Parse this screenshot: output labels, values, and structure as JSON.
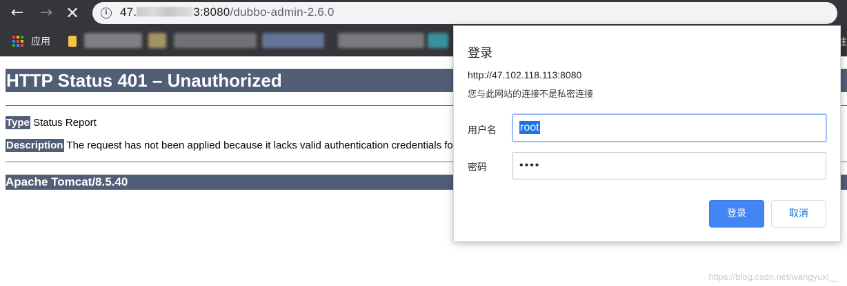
{
  "browser": {
    "url_host_prefix": "47.",
    "url_host_suffix": "3:8080",
    "url_path": "/dubbo-admin-2.6.0",
    "icons": {
      "back": "arrow-left-icon",
      "forward": "arrow-right-icon",
      "stop": "close-icon",
      "info": "info-icon"
    }
  },
  "bookmarks": {
    "apps_label": "应用",
    "right_fragment": "注"
  },
  "page": {
    "title": "HTTP Status 401 – Unauthorized",
    "type_label": "Type",
    "type_value": " Status Report",
    "description_label": "Description",
    "description_value": " The request has not been applied because it lacks valid authentication credentials fo",
    "footer": "Apache Tomcat/8.5.40"
  },
  "dialog": {
    "title": "登录",
    "host": "http://47.102.118.113:8080",
    "note": "您与此网站的连接不是私密连接",
    "username_label": "用户名",
    "username_value": "root",
    "password_label": "密码",
    "password_value": "••••",
    "login_button": "登录",
    "cancel_button": "取消"
  },
  "watermark": "https://blog.csdn.net/wangyuxi__",
  "colors": {
    "toolbar": "#35363a",
    "tomcat_header": "#525d76",
    "primary_button": "#4285f4"
  }
}
